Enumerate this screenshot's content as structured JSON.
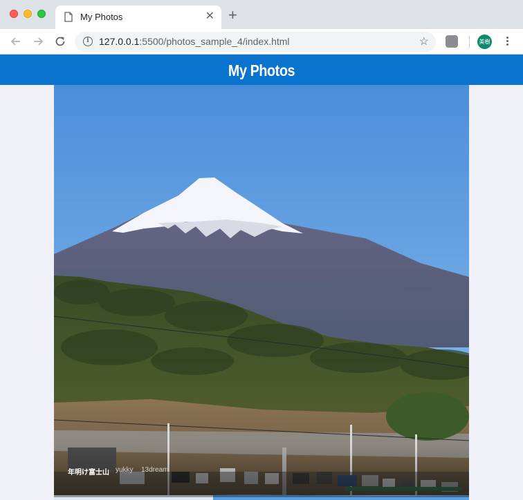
{
  "browser": {
    "tab_title": "My Photos",
    "close_glyph": "✕",
    "new_tab_glyph": "+",
    "url_host": "127.0.0.1",
    "url_rest": ":5500/photos_sample_4/index.html",
    "bookmark_glyph": "☆",
    "avatar_text": "美樹",
    "info_glyph": "i"
  },
  "page": {
    "header_title": "My Photos",
    "header_color": "#0a73ce",
    "photo": {
      "title": "年明け富士山",
      "author": "yukky",
      "tag": "13dream"
    }
  }
}
